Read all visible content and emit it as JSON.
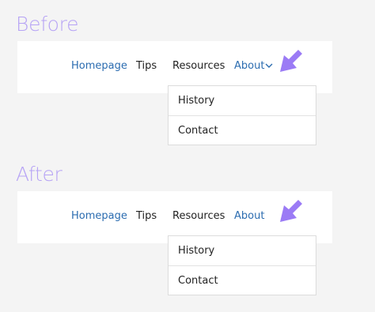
{
  "before": {
    "label": "Before",
    "nav": {
      "homepage": "Homepage",
      "tips": "Tips",
      "resources": "Resources",
      "about": "About"
    },
    "dropdown": [
      "History",
      "Contact"
    ]
  },
  "after": {
    "label": "After",
    "nav": {
      "homepage": "Homepage",
      "tips": "Tips",
      "resources": "Resources",
      "about": "About"
    },
    "dropdown": [
      "History",
      "Contact"
    ]
  },
  "colors": {
    "link": "#2b6cb0",
    "arrow": "#9b7bf5",
    "label": "#b6a3f5"
  },
  "icons": {
    "pointer": "pointer-arrow-icon",
    "chevron": "chevron-down-icon"
  }
}
